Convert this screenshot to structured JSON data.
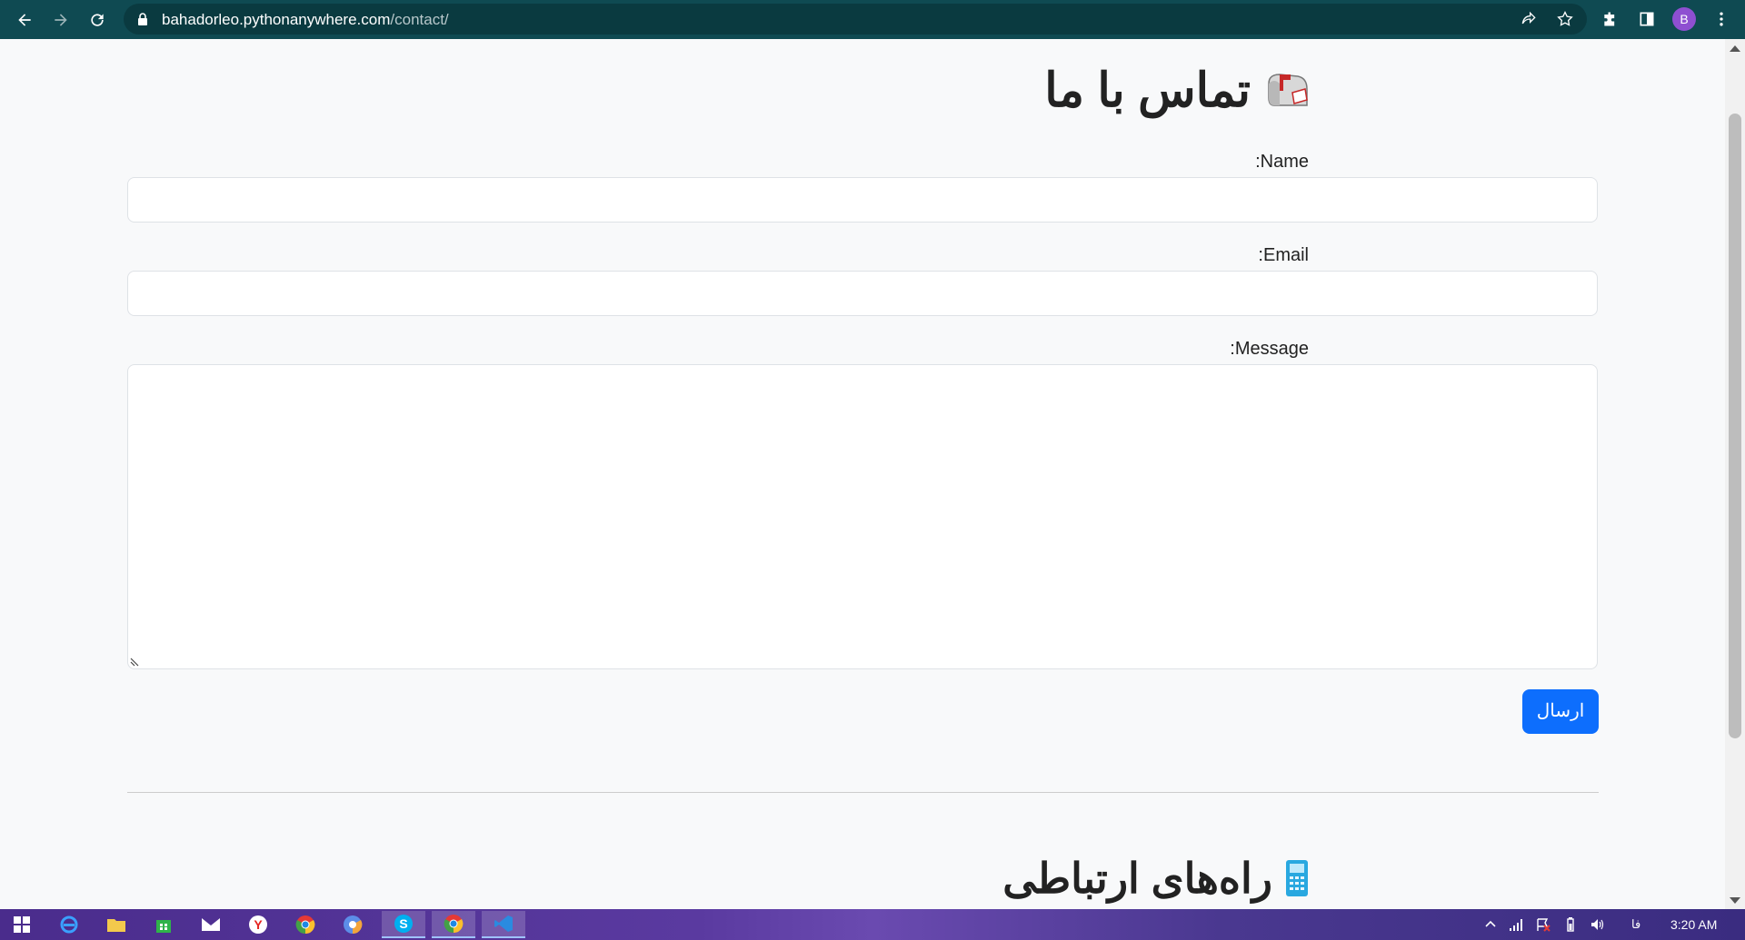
{
  "browser": {
    "url_host": "bahadorleo.pythonanywhere.com",
    "url_path": "/contact/",
    "profile_initial": "B"
  },
  "page": {
    "contact_title": "تماس با ما",
    "name_label": ":Name",
    "email_label": ":Email",
    "message_label": ":Message",
    "submit_label": "ارسال",
    "ways_title": "راه‌های ارتباطی"
  },
  "taskbar": {
    "time": "3:20 AM",
    "language": "فا"
  },
  "colors": {
    "chrome_bar": "#0f4a52",
    "submit_button": "#0d6efd",
    "profile_avatar": "#8e4fd1"
  }
}
